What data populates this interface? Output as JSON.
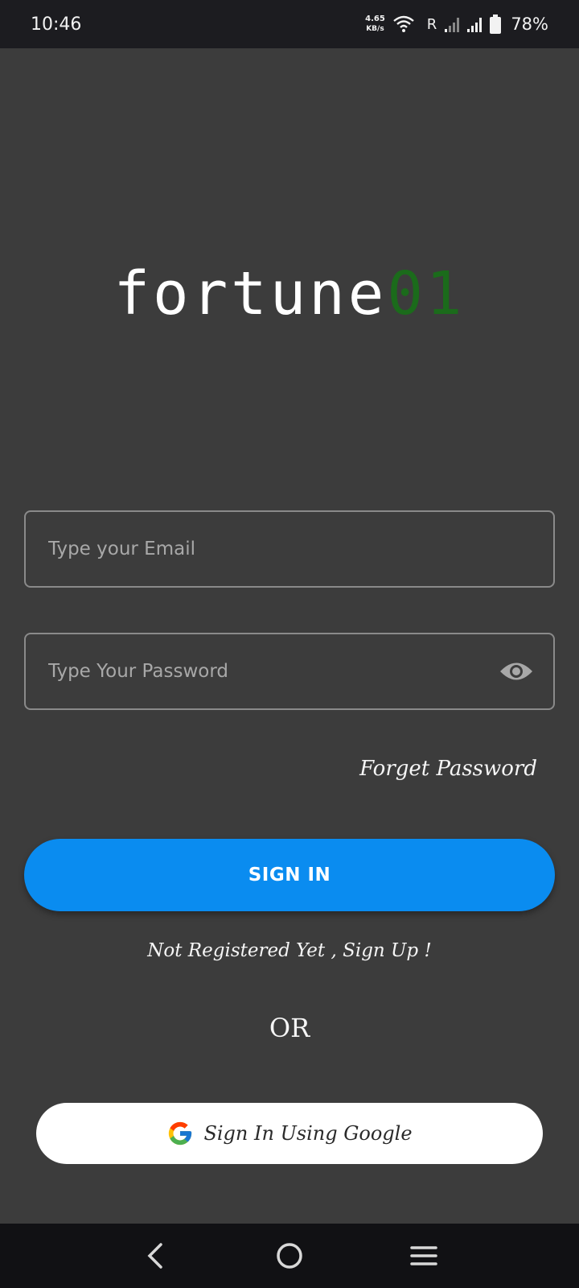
{
  "status_bar": {
    "time": "10:46",
    "net_speed_value": "4.65",
    "net_speed_unit": "KB/s",
    "roaming_label": "R",
    "battery_percent": "78%"
  },
  "logo": {
    "text": "fortune",
    "number": "01",
    "number_color": "#1b6b1b"
  },
  "form": {
    "email_placeholder": "Type your Email",
    "email_value": "",
    "password_placeholder": "Type Your Password",
    "password_value": "",
    "forget_password_label": "Forget Password",
    "sign_in_label": "SIGN IN",
    "register_label": "Not Registered Yet , Sign Up !",
    "or_label": "OR",
    "google_label": "Sign In Using Google"
  },
  "colors": {
    "background": "#3c3c3c",
    "primary_button": "#0a8cf0"
  },
  "icons": {
    "password_toggle": "eye-icon",
    "google": "google-icon",
    "nav_back": "back-chevron-icon",
    "nav_home": "home-circle-icon",
    "nav_recents": "menu-lines-icon"
  }
}
